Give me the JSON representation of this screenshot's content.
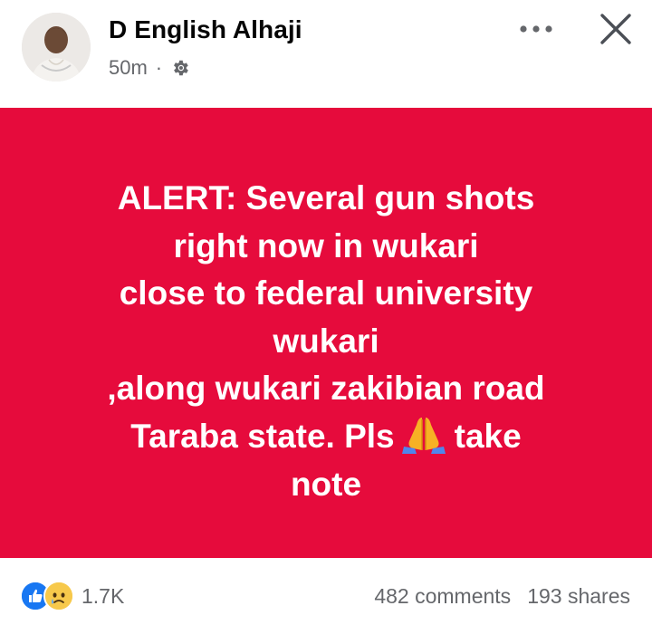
{
  "author": {
    "name": "D English Alhaji",
    "time": "50m",
    "separator": "·",
    "audience_icon": "gear-icon"
  },
  "header": {
    "more_icon": "more-horizontal-icon",
    "close_icon": "close-icon"
  },
  "post": {
    "background_color": "#e60b3c",
    "text_color": "#ffffff",
    "lines": [
      "ALERT: Several gun shots",
      "right now in wukari",
      "close to federal university",
      "wukari",
      ",along wukari zakibian road"
    ],
    "line6_before": "Taraba state. Pls",
    "line6_emoji": "folded-hands-emoji",
    "line6_after": "take",
    "line7": "note"
  },
  "footer": {
    "reaction_icons": [
      "like-icon",
      "sad-icon"
    ],
    "reaction_count": "1.7K",
    "comments": "482 comments",
    "shares": "193 shares"
  }
}
